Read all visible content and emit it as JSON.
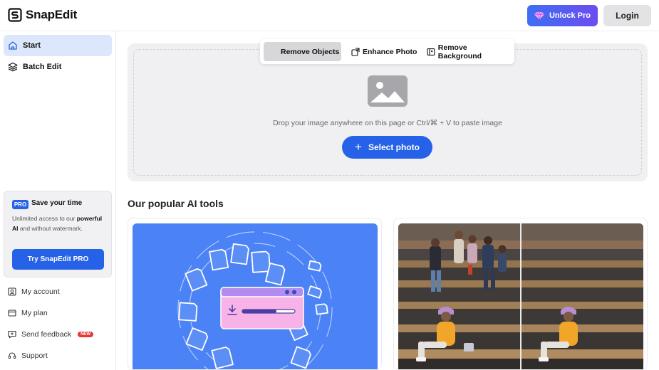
{
  "header": {
    "logo_text": "SnapEdit",
    "unlock_label": "Unlock Pro",
    "login_label": "Login"
  },
  "sidebar": {
    "nav": [
      {
        "label": "Start",
        "icon": "home-icon",
        "active": true
      },
      {
        "label": "Batch Edit",
        "icon": "layers-icon",
        "active": false
      }
    ],
    "pro_card": {
      "badge": "PRO",
      "title": "Save your time",
      "desc_prefix": "Unlimited access to our ",
      "desc_bold": "powerful AI",
      "desc_suffix": " and without watermark.",
      "button": "Try SnapEdit PRO"
    },
    "footer": [
      {
        "label": "My account",
        "icon": "account-icon"
      },
      {
        "label": "My plan",
        "icon": "plan-icon"
      },
      {
        "label": "Send feedback",
        "icon": "feedback-icon",
        "badge": "NEW"
      },
      {
        "label": "Support",
        "icon": "headset-icon"
      }
    ]
  },
  "tools_tabs": [
    {
      "label": "Remove Objects",
      "active": true
    },
    {
      "label": "Enhance Photo",
      "active": false,
      "icon": "enhance-icon"
    },
    {
      "label": "Remove Background",
      "active": false,
      "icon": "remove-bg-icon"
    }
  ],
  "dropzone": {
    "hint": "Drop your image anywhere on this page or Ctrl/⌘ + V to paste image",
    "button": "Select photo"
  },
  "popular": {
    "title": "Our popular AI tools"
  },
  "colors": {
    "primary": "#2662e8",
    "unlock_gradient_start": "#3d6ff2",
    "unlock_gradient_end": "#6d4cf0",
    "card_blue": "#4b82f5",
    "active_nav": "#dde7fb"
  }
}
